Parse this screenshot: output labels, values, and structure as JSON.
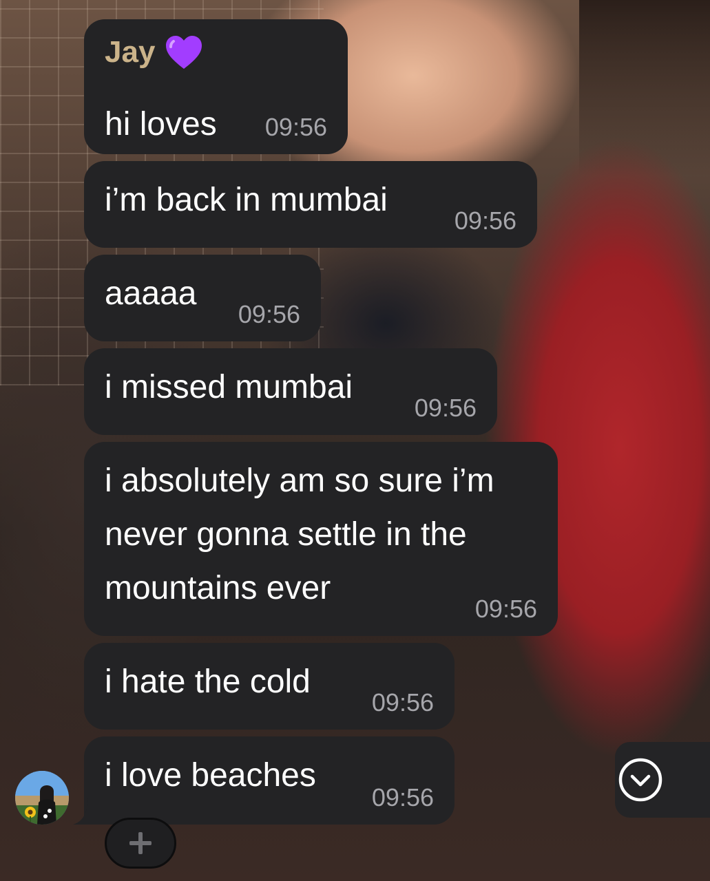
{
  "chat": {
    "sender_name": "Jay",
    "sender_emoji_icon": "purple-heart-icon",
    "messages": [
      {
        "text": "hi loves",
        "time": "09:56"
      },
      {
        "text": "i’m back in mumbai",
        "time": "09:56"
      },
      {
        "text": "aaaaa",
        "time": "09:56"
      },
      {
        "text": "i missed mumbai",
        "time": "09:56"
      },
      {
        "text": "i absolutely am so sure i’m\nnever gonna settle in the\nmountains ever",
        "time": "09:56"
      },
      {
        "text": "i hate the cold",
        "time": "09:56"
      },
      {
        "text": "i love beaches",
        "time": "09:56"
      }
    ]
  },
  "controls": {
    "add_reaction_icon": "plus-icon",
    "scroll_down_icon": "chevron-down-circle-icon"
  },
  "colors": {
    "bubble_background": "#232325",
    "sender_name": "#cbb38a",
    "timestamp": "#a6a6ab",
    "heart": "#a23dff"
  }
}
